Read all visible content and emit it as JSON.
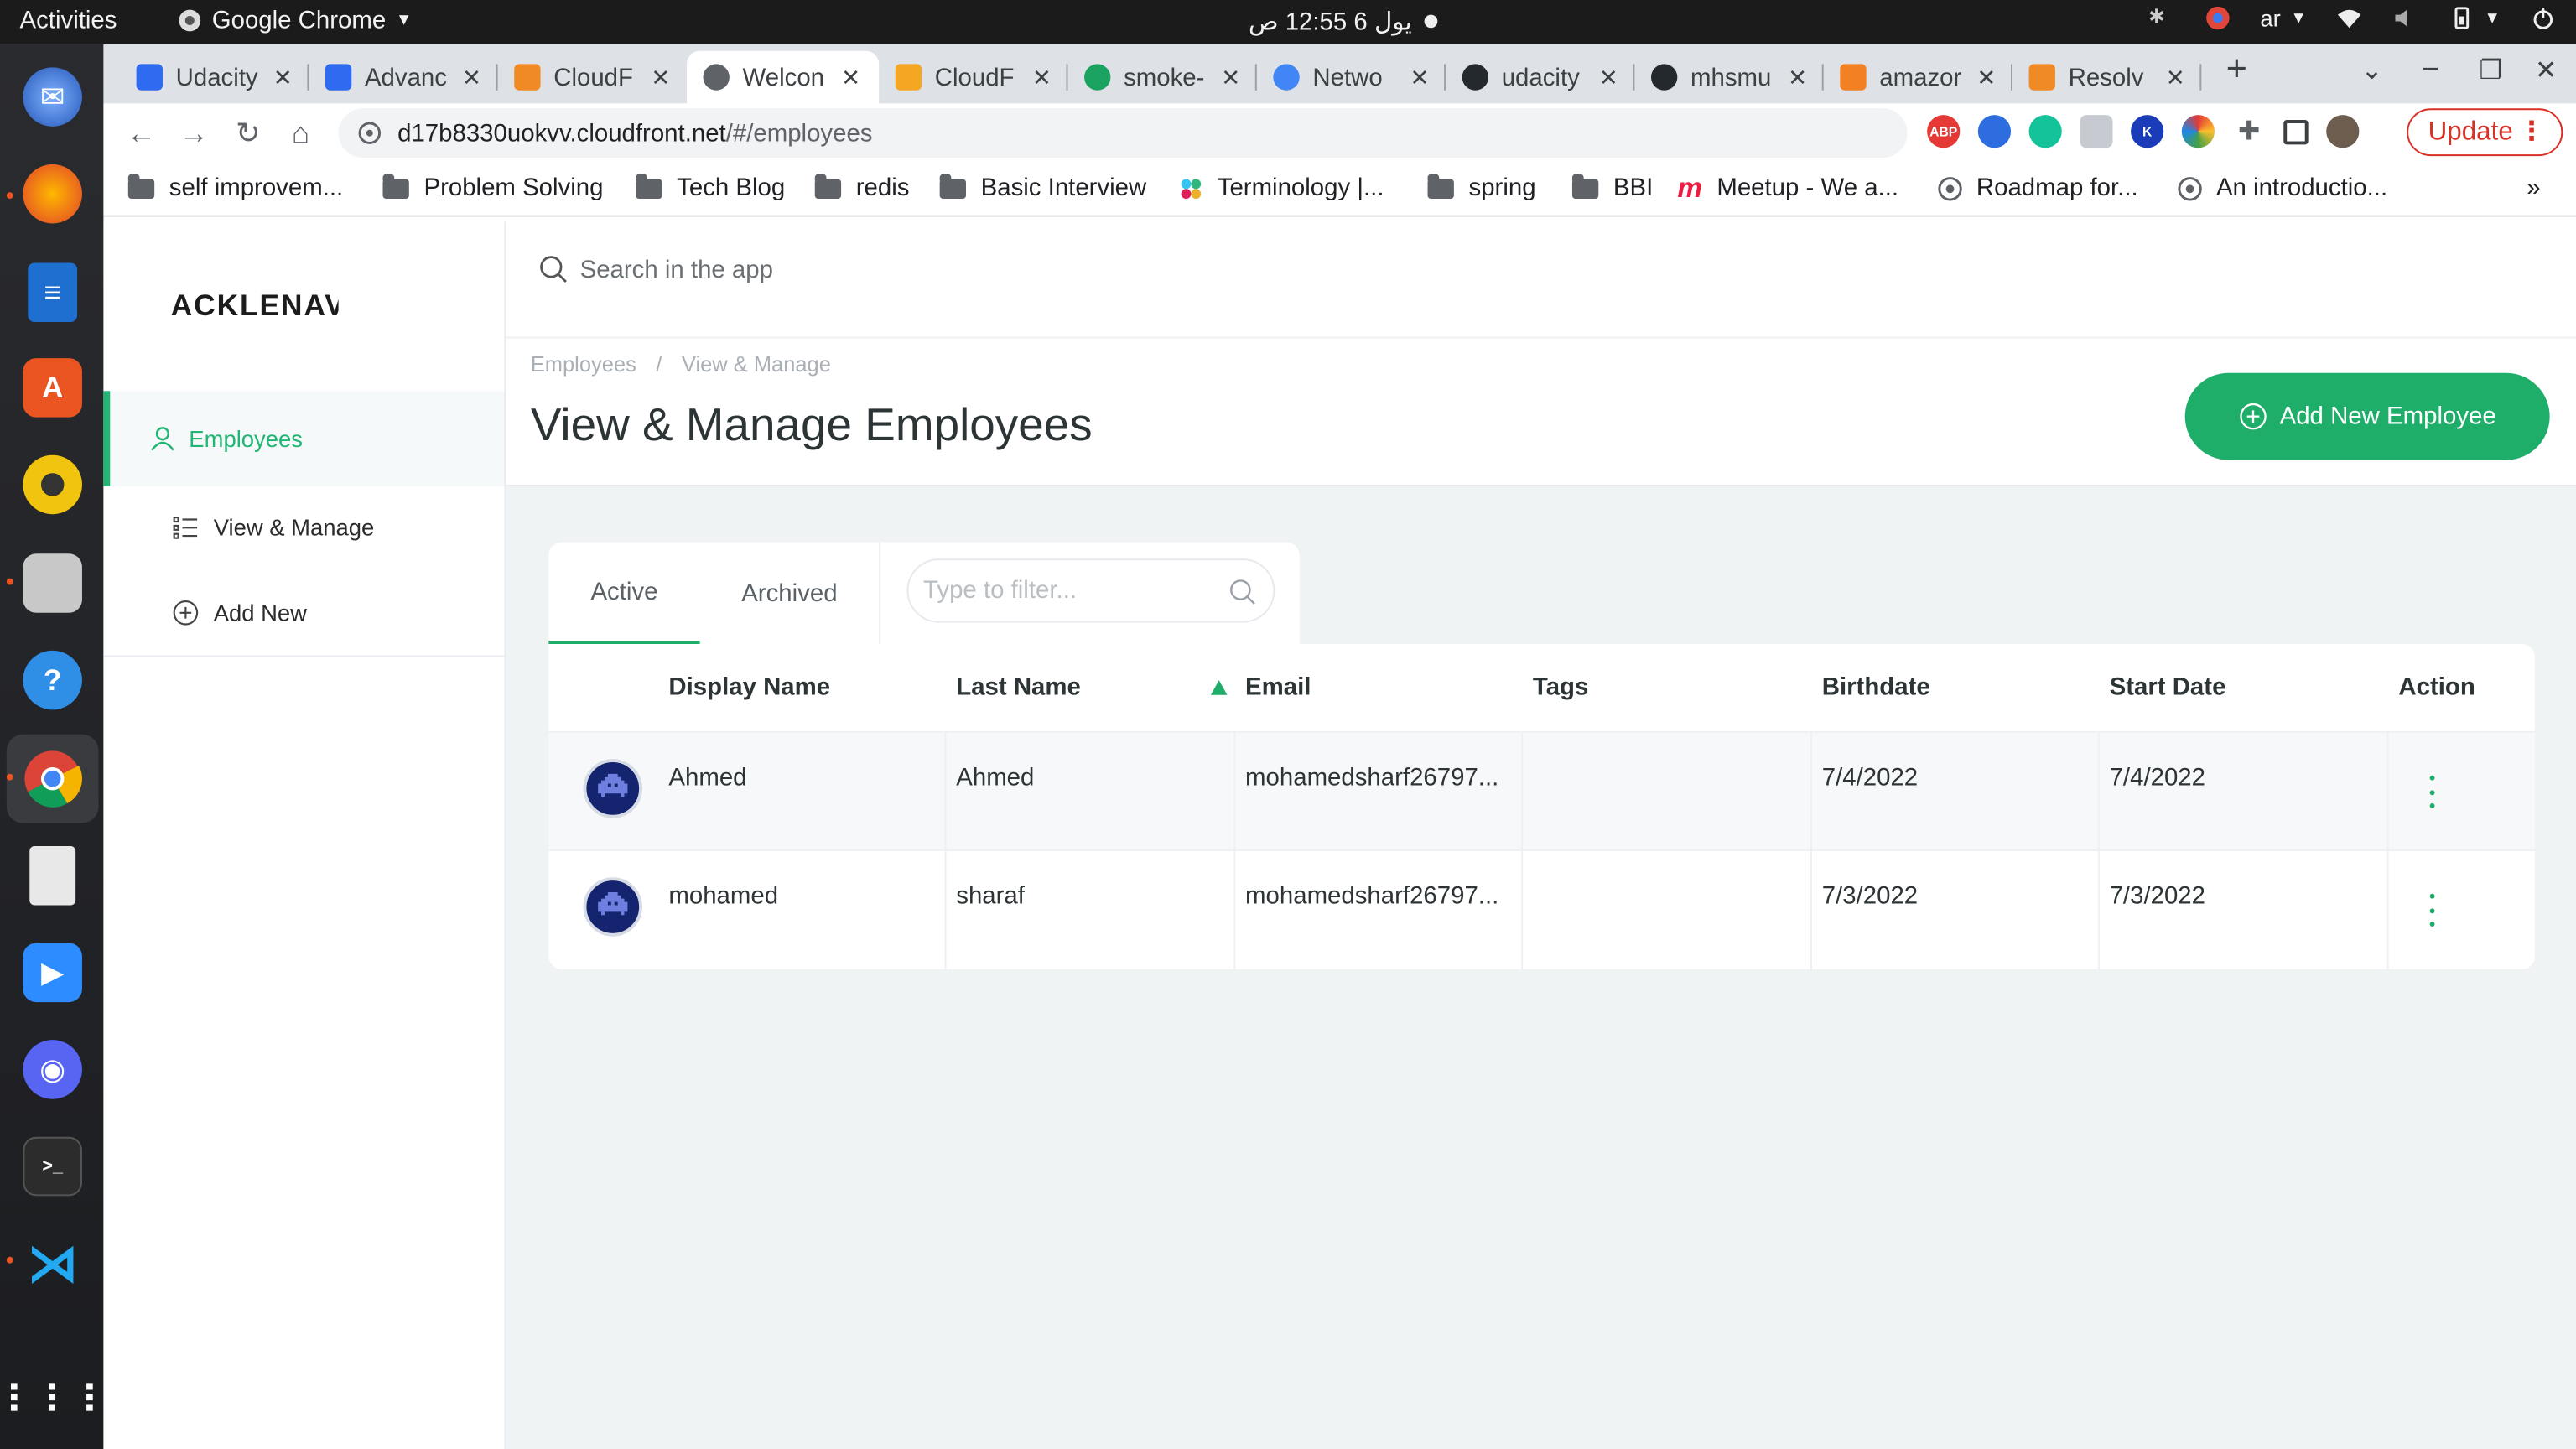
{
  "os": {
    "activities": "Activities",
    "app_name": "Google Chrome",
    "clock": "يول 6  12:55 ص",
    "lang": "ar"
  },
  "tabs": [
    {
      "title": "Udacity",
      "color": "#2e6bf0"
    },
    {
      "title": "Advanc",
      "color": "#2e6bf0"
    },
    {
      "title": "CloudF",
      "color": "#f08a24"
    },
    {
      "title": "Welcon",
      "color": "#5f6368"
    },
    {
      "title": "CloudF",
      "color": "#f5a623"
    },
    {
      "title": "smoke-",
      "color": "#1aa260"
    },
    {
      "title": "Netwo",
      "color": "#4285f4"
    },
    {
      "title": "udacity",
      "color": "#24292e"
    },
    {
      "title": "mhsmu",
      "color": "#24292e"
    },
    {
      "title": "amazor",
      "color": "#f48024"
    },
    {
      "title": "Resolv",
      "color": "#f08a24"
    }
  ],
  "toolbar": {
    "url_host": "d17b8330uokvv.cloudfront.net",
    "url_path": "/#/employees",
    "update_label": "Update"
  },
  "bookmarks": [
    {
      "label": "self improvem...",
      "icon": "folder-icon"
    },
    {
      "label": "Problem Solving",
      "icon": "folder-icon"
    },
    {
      "label": "Tech Blog",
      "icon": "folder-icon"
    },
    {
      "label": "redis",
      "icon": "folder-icon"
    },
    {
      "label": "Basic Interview",
      "icon": "folder-icon"
    },
    {
      "label": "Terminology |...",
      "icon": "slack-icon"
    },
    {
      "label": "spring",
      "icon": "folder-icon"
    },
    {
      "label": "BBI",
      "icon": "folder-icon"
    },
    {
      "label": "Meetup - We a...",
      "icon": "meetup-icon"
    },
    {
      "label": "Roadmap for...",
      "icon": "globe-icon"
    },
    {
      "label": "An introductio...",
      "icon": "globe-icon"
    }
  ],
  "app": {
    "logo": "ACKLENAVENUE",
    "search_placeholder": "Search in the app",
    "sidebar": {
      "group": "Employees",
      "items": [
        "View & Manage",
        "Add New"
      ]
    },
    "breadcrumb": [
      "Employees",
      "/",
      "View & Manage"
    ],
    "title": "View & Manage Employees",
    "add_button": "Add New Employee",
    "tabs": [
      "Active",
      "Archived"
    ],
    "filter_placeholder": "Type to filter...",
    "columns": [
      "Display Name",
      "Last Name",
      "Email",
      "Tags",
      "Birthdate",
      "Start Date",
      "Action"
    ],
    "rows": [
      {
        "display_name": "Ahmed",
        "last_name": "Ahmed",
        "email": "mohamedsharf26797...",
        "tags": "",
        "birthdate": "7/4/2022",
        "start_date": "7/4/2022"
      },
      {
        "display_name": "mohamed",
        "last_name": "sharaf",
        "email": "mohamedsharf26797...",
        "tags": "",
        "birthdate": "7/3/2022",
        "start_date": "7/3/2022"
      }
    ]
  },
  "colors": {
    "accent": "#1fae6a",
    "update": "#d93025"
  }
}
